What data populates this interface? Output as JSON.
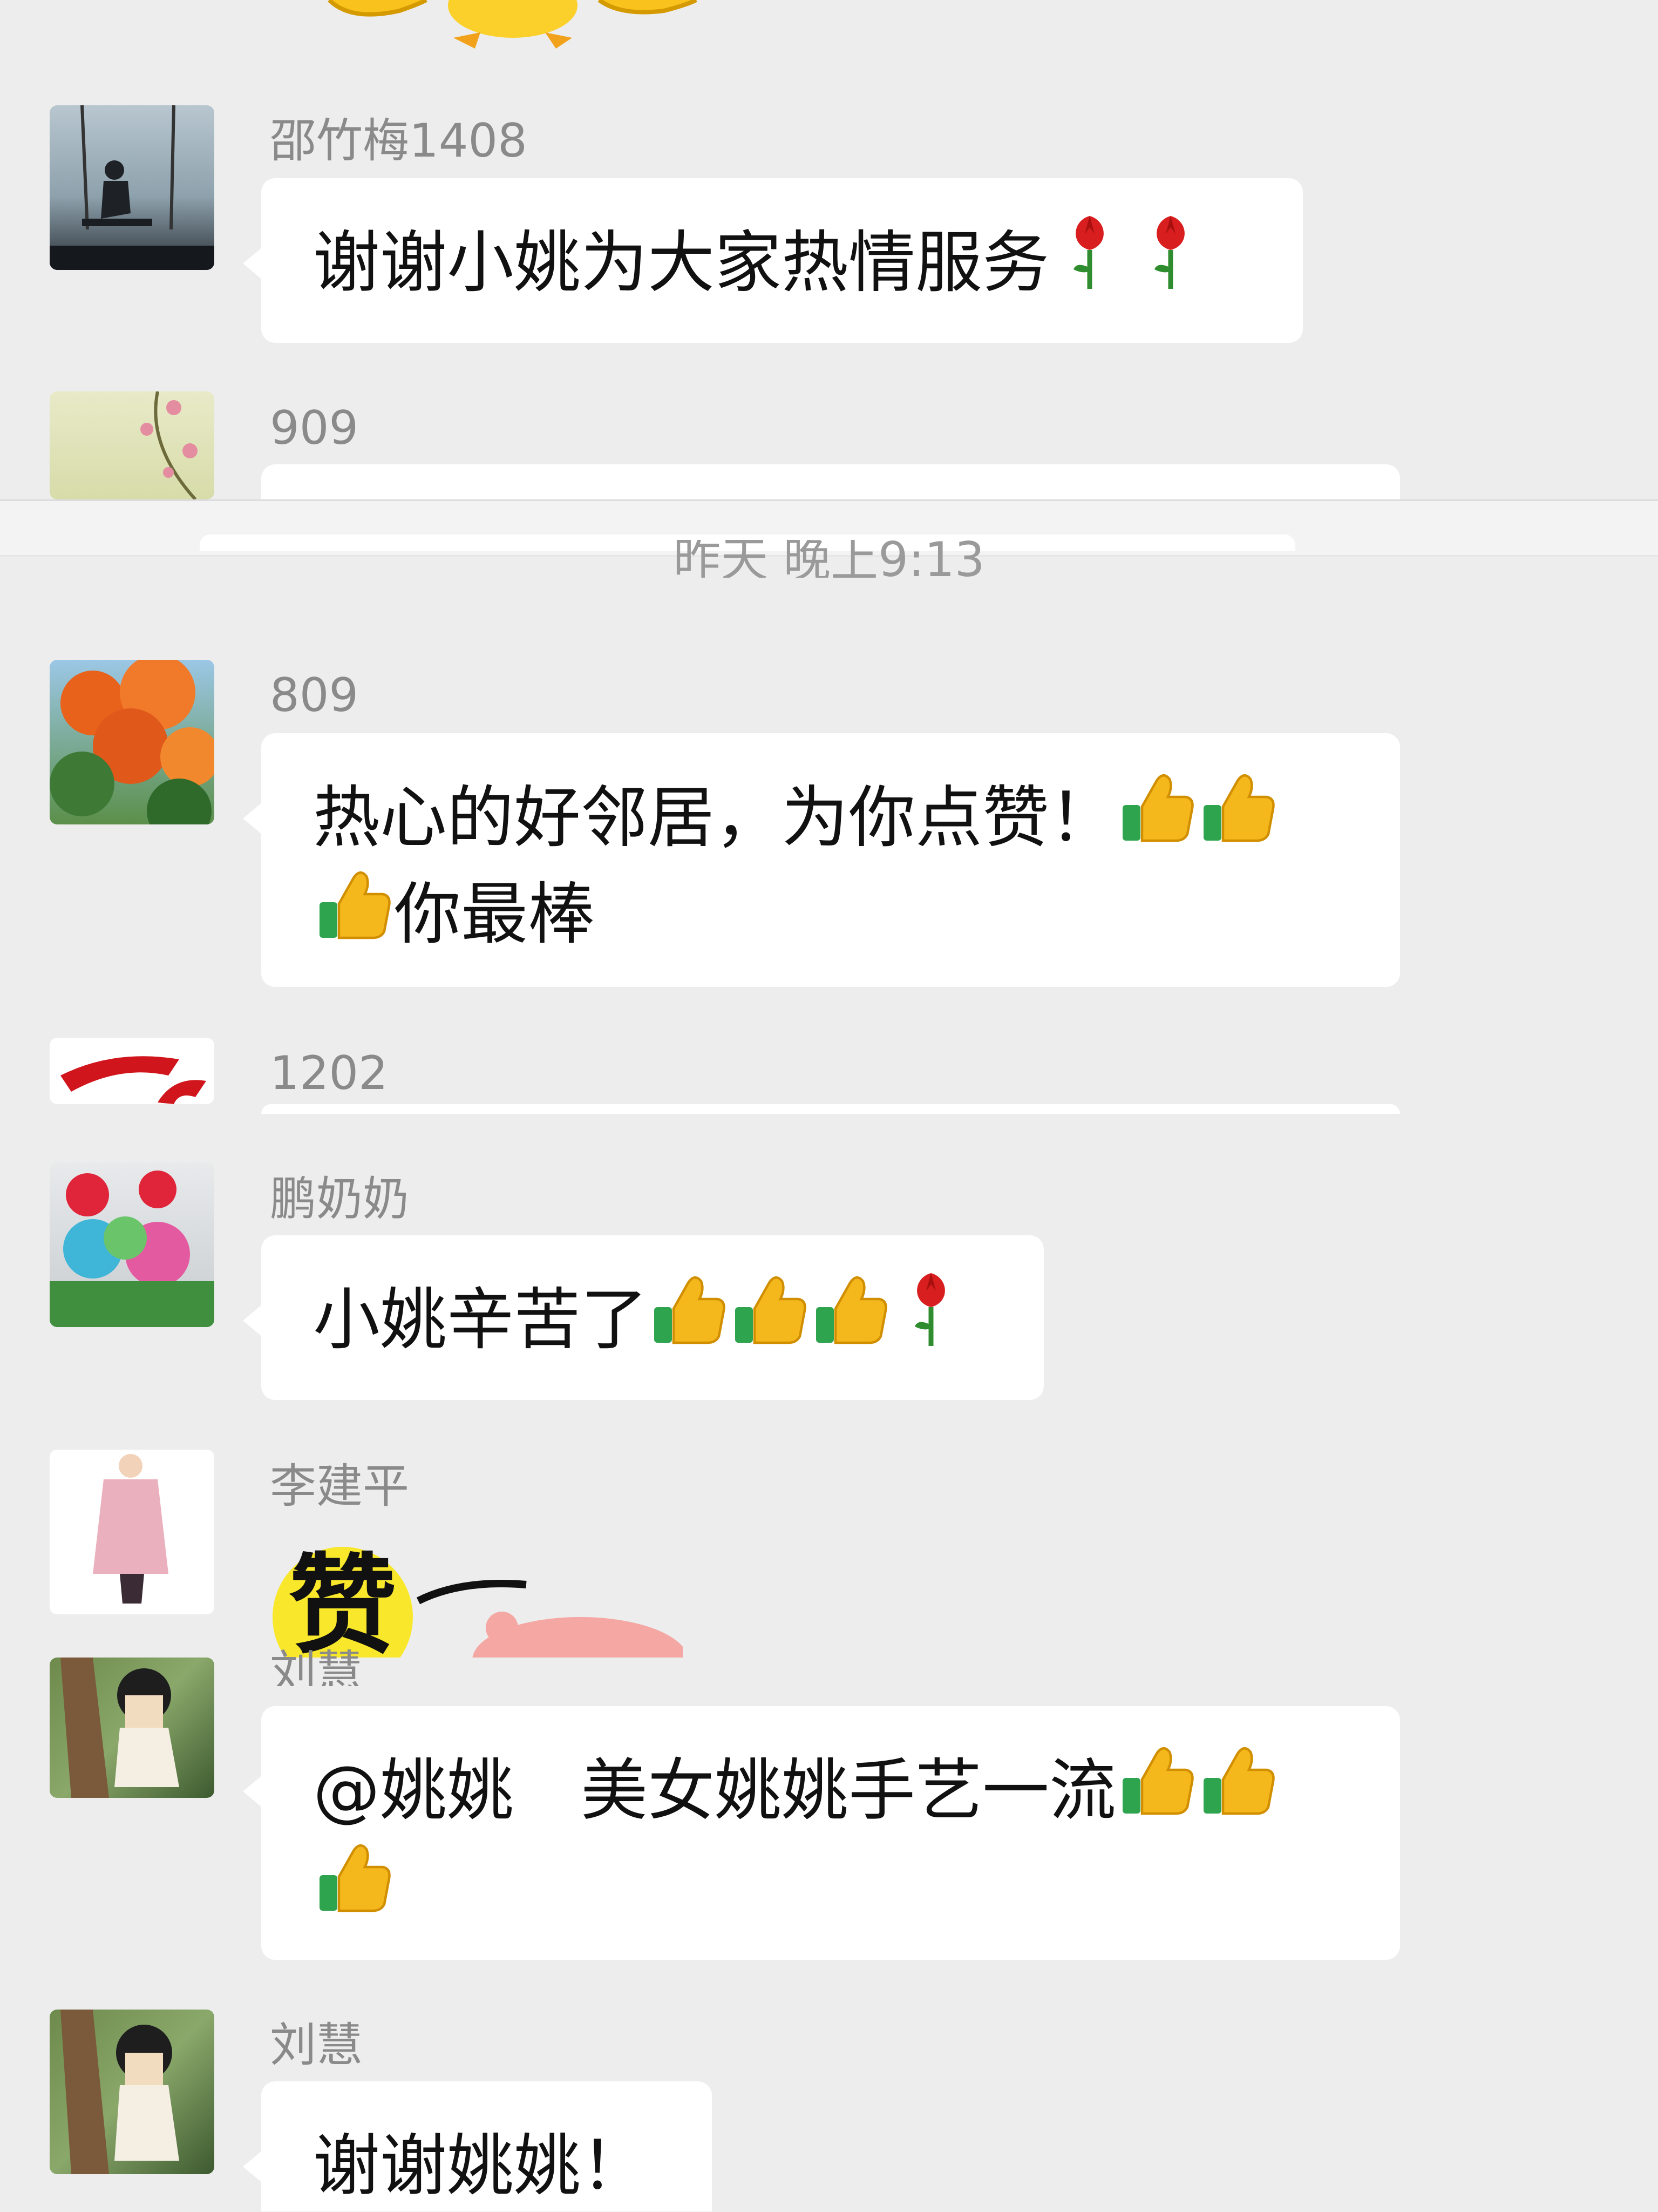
{
  "messages": [
    {
      "sender": "邵竹梅1408",
      "text": "谢谢小姚为大家热情服务",
      "emojis": [
        "rose-icon",
        "rose-icon"
      ]
    },
    {
      "sender": "909"
    },
    {
      "sender": "809",
      "line1": "热心的好邻居，为你点赞！",
      "line1_emojis": [
        "thumbs-up-icon",
        "thumbs-up-icon"
      ],
      "line2": "你最棒",
      "line2_emojis": [
        "thumbs-up-icon"
      ]
    },
    {
      "sender": "1202"
    },
    {
      "sender": "鹏奶奶",
      "text": "小姚辛苦了",
      "emojis": [
        "thumbs-up-icon",
        "thumbs-up-icon",
        "thumbs-up-icon",
        "rose-icon"
      ]
    },
    {
      "sender": "李建平",
      "sticker_text": "赞"
    },
    {
      "sender": "刘慧",
      "line1": "@姚姚　美女姚姚手艺一流",
      "line1_emojis": [
        "thumbs-up-icon",
        "thumbs-up-icon"
      ],
      "line2_emojis": [
        "thumbs-up-icon"
      ]
    },
    {
      "sender": "刘慧",
      "text": "谢谢姚姚！"
    }
  ],
  "timestamp": "昨天 晚上9:13",
  "colors": {
    "background": "#ededed",
    "bubble": "#ffffff",
    "name": "#8a8a8a",
    "rose": "#d81e1e",
    "thumb": "#f5b81c"
  }
}
